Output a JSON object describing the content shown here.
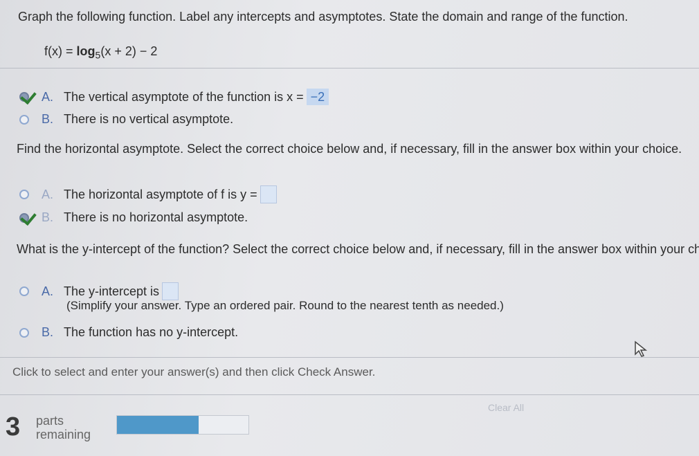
{
  "header": {
    "instruction": "Graph the following function. Label any intercepts and asymptotes. State the domain and range of the function.",
    "function_lhs": "f(x) =",
    "function_log": "log",
    "function_base": "5",
    "function_rhs": "(x + 2) − 2"
  },
  "vertical_asymptote": {
    "options": [
      {
        "letter": "A.",
        "text": "The vertical asymptote of the function is x =",
        "value": "−2",
        "selected": true
      },
      {
        "letter": "B.",
        "text": "There is no vertical asymptote.",
        "selected": false
      }
    ]
  },
  "horizontal_asymptote": {
    "question": "Find the horizontal asymptote. Select the correct choice below and, if necessary, fill in the answer box within your choice.",
    "options": [
      {
        "letter": "A.",
        "text": "The horizontal asymptote of f is y =",
        "selected": false
      },
      {
        "letter": "B.",
        "text": "There is no horizontal asymptote.",
        "selected": true
      }
    ]
  },
  "y_intercept": {
    "question": "What is the y-intercept of the function? Select the correct choice below and, if necessary, fill in the answer box within your ch",
    "options": [
      {
        "letter": "A.",
        "text": "The y-intercept is",
        "hint": "(Simplify your answer. Type an ordered pair. Round to the nearest tenth as needed.)",
        "selected": false
      },
      {
        "letter": "B.",
        "text": "The function has no y-intercept.",
        "selected": false
      }
    ]
  },
  "footer": {
    "instruction": "Click to select and enter your answer(s) and then click Check Answer.",
    "parts_count": "3",
    "parts_label_1": "parts",
    "parts_label_2": "remaining",
    "progress_fraction": 0.62,
    "clear_all_label": "Clear All"
  },
  "colors": {
    "accent": "#4a6aa8",
    "progress": "#4f98c9",
    "check": "#2e7d32"
  }
}
